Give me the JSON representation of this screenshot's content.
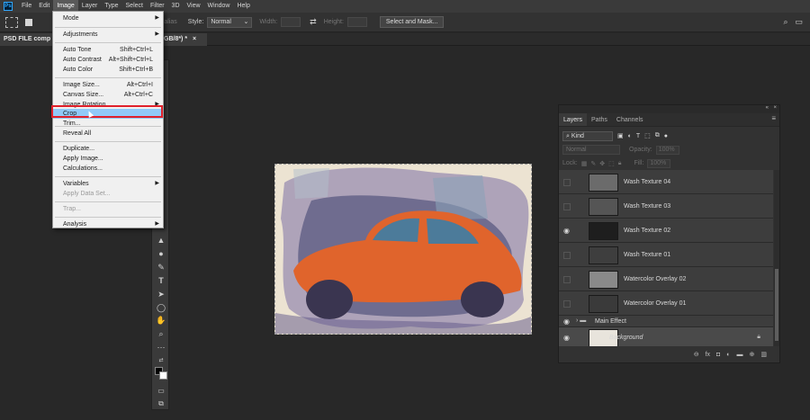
{
  "app": {
    "logo": "Ps"
  },
  "menubar": {
    "items": [
      "File",
      "Edit",
      "Image",
      "Layer",
      "Type",
      "Select",
      "Filter",
      "3D",
      "View",
      "Window",
      "Help"
    ]
  },
  "options": {
    "anti_alias": "Anti-alias",
    "style_label": "Style:",
    "style_value": "Normal",
    "width_label": "Width:",
    "height_label": "Height:",
    "swap_icon": "⇄",
    "select_mask": "Select and Mask...",
    "search_icon": "⌕",
    "workspace_icon": "▭"
  },
  "document": {
    "tab_left": "PSD FILE comp",
    "tab_right": "GB/8*) *",
    "close": "×"
  },
  "image_menu": [
    {
      "label": "Mode",
      "shortcut": "",
      "arrow": true,
      "disabled": false
    },
    {
      "label": "Adjustments",
      "shortcut": "",
      "arrow": true,
      "disabled": false
    },
    {
      "label": "Auto Tone",
      "shortcut": "Shift+Ctrl+L",
      "arrow": false,
      "disabled": false
    },
    {
      "label": "Auto Contrast",
      "shortcut": "Alt+Shift+Ctrl+L",
      "arrow": false,
      "disabled": false
    },
    {
      "label": "Auto Color",
      "shortcut": "Shift+Ctrl+B",
      "arrow": false,
      "disabled": false
    },
    {
      "label": "Image Size...",
      "shortcut": "Alt+Ctrl+I",
      "arrow": false,
      "disabled": false
    },
    {
      "label": "Canvas Size...",
      "shortcut": "Alt+Ctrl+C",
      "arrow": false,
      "disabled": false
    },
    {
      "label": "Image Rotation",
      "shortcut": "",
      "arrow": true,
      "disabled": false
    },
    {
      "label": "Crop",
      "shortcut": "",
      "arrow": false,
      "disabled": false
    },
    {
      "label": "Trim...",
      "shortcut": "",
      "arrow": false,
      "disabled": false
    },
    {
      "label": "Reveal All",
      "shortcut": "",
      "arrow": false,
      "disabled": false
    },
    {
      "label": "Duplicate...",
      "shortcut": "",
      "arrow": false,
      "disabled": false
    },
    {
      "label": "Apply Image...",
      "shortcut": "",
      "arrow": false,
      "disabled": false
    },
    {
      "label": "Calculations...",
      "shortcut": "",
      "arrow": false,
      "disabled": false
    },
    {
      "label": "Variables",
      "shortcut": "",
      "arrow": true,
      "disabled": false
    },
    {
      "label": "Apply Data Set...",
      "shortcut": "",
      "arrow": false,
      "disabled": true
    },
    {
      "label": "Trap...",
      "shortcut": "",
      "arrow": false,
      "disabled": true
    },
    {
      "label": "Analysis",
      "shortcut": "",
      "arrow": true,
      "disabled": false
    }
  ],
  "layers_panel": {
    "tabs": [
      "Layers",
      "Paths",
      "Channels"
    ],
    "kind": "Kind",
    "blend": "Normal",
    "opacity_label": "Opacity:",
    "opacity_value": "100%",
    "lock_label": "Lock:",
    "fill_label": "Fill:",
    "fill_value": "100%",
    "layers": [
      {
        "name": "Wash Texture 04",
        "visible": false
      },
      {
        "name": "Wash Texture 03",
        "visible": false
      },
      {
        "name": "Wash Texture 02",
        "visible": true
      },
      {
        "name": "Wash Texture 01",
        "visible": false
      },
      {
        "name": "Watercolor Overlay 02",
        "visible": false
      },
      {
        "name": "Watercolor Overlay 01",
        "visible": false
      },
      {
        "name": "Main Effect",
        "visible": true
      },
      {
        "name": "Background",
        "visible": true
      }
    ],
    "footer_icons": [
      "link-icon",
      "fx-icon",
      "mask-icon",
      "adjustment-icon",
      "folder-icon",
      "new-layer-icon",
      "trash-icon"
    ]
  },
  "colors": {
    "accent_highlight": "#91c9f7",
    "crop_outline": "#e0202a",
    "car": "#e0642c"
  }
}
